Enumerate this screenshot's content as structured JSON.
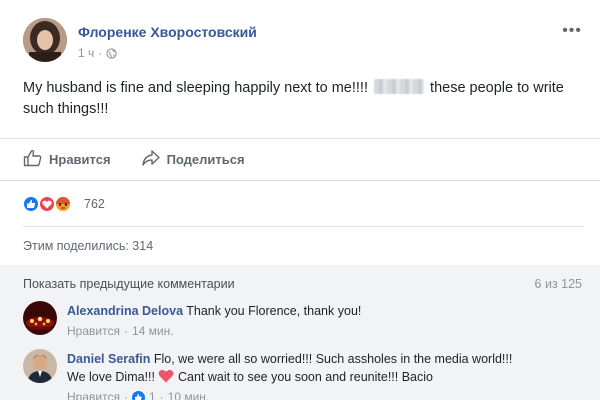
{
  "post": {
    "author": "Флоренке Хворостовский",
    "time": "1 ч",
    "dot": "·",
    "more_icon": "more-options-icon",
    "text_before": "My husband is fine and sleeping happily next to me!!!!",
    "text_after": "these people to write such things!!!"
  },
  "actions": {
    "like_label": "Нравится",
    "share_label": "Поделиться"
  },
  "reactions": {
    "types": [
      "like",
      "love",
      "angry"
    ],
    "count": "762"
  },
  "shares": {
    "label": "Этим поделились: 314"
  },
  "comments": {
    "show_previous": "Показать предыдущие комментарии",
    "counter": "6 из 125",
    "items": [
      {
        "author": "Alexandrina Delova",
        "text": "Thank you Florence, thank you!",
        "like_label": "Нравится",
        "dot": "·",
        "time": "14 мин."
      },
      {
        "author": "Daniel Serafin",
        "text_line1": "Flo, we were all so worried!!! Such assholes in the media world!!!",
        "text_line2a": "We love Dima!!!",
        "text_line2b": "Cant wait to see you soon and reunite!!! Bacio",
        "like_label": "Нравится",
        "dot": "·",
        "likes": "1",
        "time": "10 мин."
      }
    ]
  },
  "colors": {
    "link_blue": "#365899",
    "like_blue": "#1877f2",
    "love_red": "#f33e58",
    "angry_orange": "#f0a125",
    "muted_gray": "#90949c"
  }
}
